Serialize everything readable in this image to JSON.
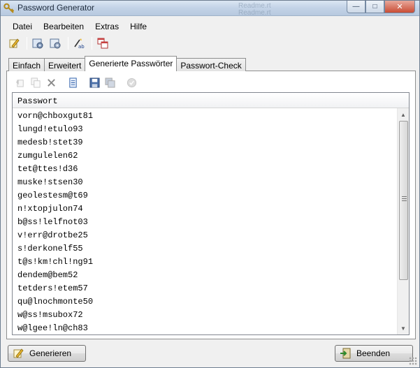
{
  "window": {
    "title": "Password Generator",
    "background_ghost_text": [
      "Readme.rt",
      "Readme.rt"
    ]
  },
  "menu": {
    "items": [
      {
        "label": "Datei",
        "name": "menu-datei"
      },
      {
        "label": "Bearbeiten",
        "name": "menu-bearbeiten"
      },
      {
        "label": "Extras",
        "name": "menu-extras"
      },
      {
        "label": "Hilfe",
        "name": "menu-hilfe"
      }
    ]
  },
  "toolbar": {
    "icons": [
      "generate-icon",
      "settings-icon",
      "settings-alt-icon",
      "spell-check-icon",
      "window-stack-icon"
    ]
  },
  "tabs": [
    {
      "label": "Einfach",
      "name": "tab-einfach",
      "active": false
    },
    {
      "label": "Erweitert",
      "name": "tab-erweitert",
      "active": false
    },
    {
      "label": "Generierte Passwörter",
      "name": "tab-generierte-passwoerter",
      "active": true
    },
    {
      "label": "Passwort-Check",
      "name": "tab-passwort-check",
      "active": false
    }
  ],
  "inner_toolbar": {
    "icons": [
      "add-icon",
      "copy-icon",
      "delete-icon",
      "document-icon",
      "save-icon",
      "save-all-icon",
      "check-icon"
    ]
  },
  "list": {
    "column_header": "Passwort",
    "rows": [
      "vorn@chboxgut81",
      "lungd!etulo93",
      "medesb!stet39",
      "zumgulelen62",
      "tet@ttes!d36",
      "muske!stsen30",
      "geolestesm@t69",
      "n!xtopjulon74",
      "b@ss!lelfnot03",
      "v!err@drotbe25",
      "s!derkonelf55",
      "t@s!km!chl!ng91",
      "dendem@bem52",
      "tetders!etem57",
      "qu@lnochmonte50",
      "w@ss!msubox72",
      "w@lgee!ln@ch83"
    ]
  },
  "footer": {
    "generate_label": "Generieren",
    "close_label": "Beenden"
  },
  "colors": {
    "titlebar": "#c3d3e7",
    "window_bg": "#f0f0f0"
  }
}
